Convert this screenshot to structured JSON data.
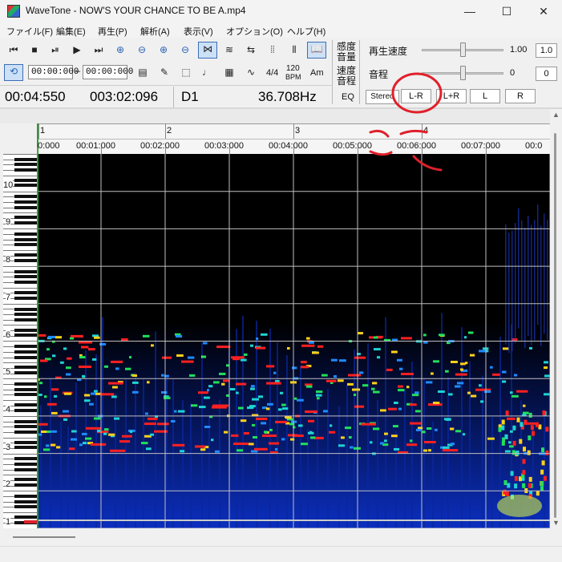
{
  "window": {
    "title": "WaveTone - NOW'S YOUR CHANCE TO BE A.mp4",
    "minimize_glyph": "—",
    "maximize_glyph": "☐",
    "close_glyph": "✕"
  },
  "menu": [
    "ファイル(F)",
    "編集(E)",
    "再生(P)",
    "解析(A)",
    "表示(V)",
    "オプション(O)",
    "ヘルプ(H)"
  ],
  "toolbar": {
    "range_start": "00:00:000",
    "range_sep": "–",
    "range_end": "00:00:000",
    "time_sig": "4/4",
    "bpm_value": "120",
    "bpm_unit": "BPM",
    "key": "Am",
    "sens_label_1": "感度",
    "sens_label_2": "音量",
    "speed_label_1": "速度",
    "speed_label_2": "音程",
    "eq_label": "EQ"
  },
  "playback": {
    "speed_label": "再生速度",
    "speed_value": "1.00",
    "speed_reset": "1.0",
    "pitch_label": "音程",
    "pitch_value": "0",
    "pitch_reset": "0",
    "speed_level": 0.5,
    "pitch_level": 0.5
  },
  "channels": [
    "Stereo",
    "L-R",
    "L+R",
    "L",
    "R"
  ],
  "status": {
    "position": "00:04:550",
    "length": "003:02:096",
    "note": "D1",
    "frequency": "36.708Hz"
  },
  "ruler": {
    "bars": [
      "1",
      "2",
      "3",
      "4"
    ],
    "times": [
      "0:000",
      "00:01:000",
      "00:02:000",
      "00:03:000",
      "00:04:000",
      "00:05:000",
      "00:06:000",
      "00:07:000",
      "00:0"
    ]
  },
  "octaves": [
    "10",
    "9",
    "8",
    "7",
    "6",
    "5",
    "4",
    "3",
    "2",
    "1"
  ],
  "colors": {
    "accent_blue": "#3b6fb6",
    "annotation_red": "#e0202a",
    "spectrum_low": "#0a1fa8",
    "spectrum_mid": "#1fd3d3",
    "spectrum_peak": "#ff2020"
  }
}
